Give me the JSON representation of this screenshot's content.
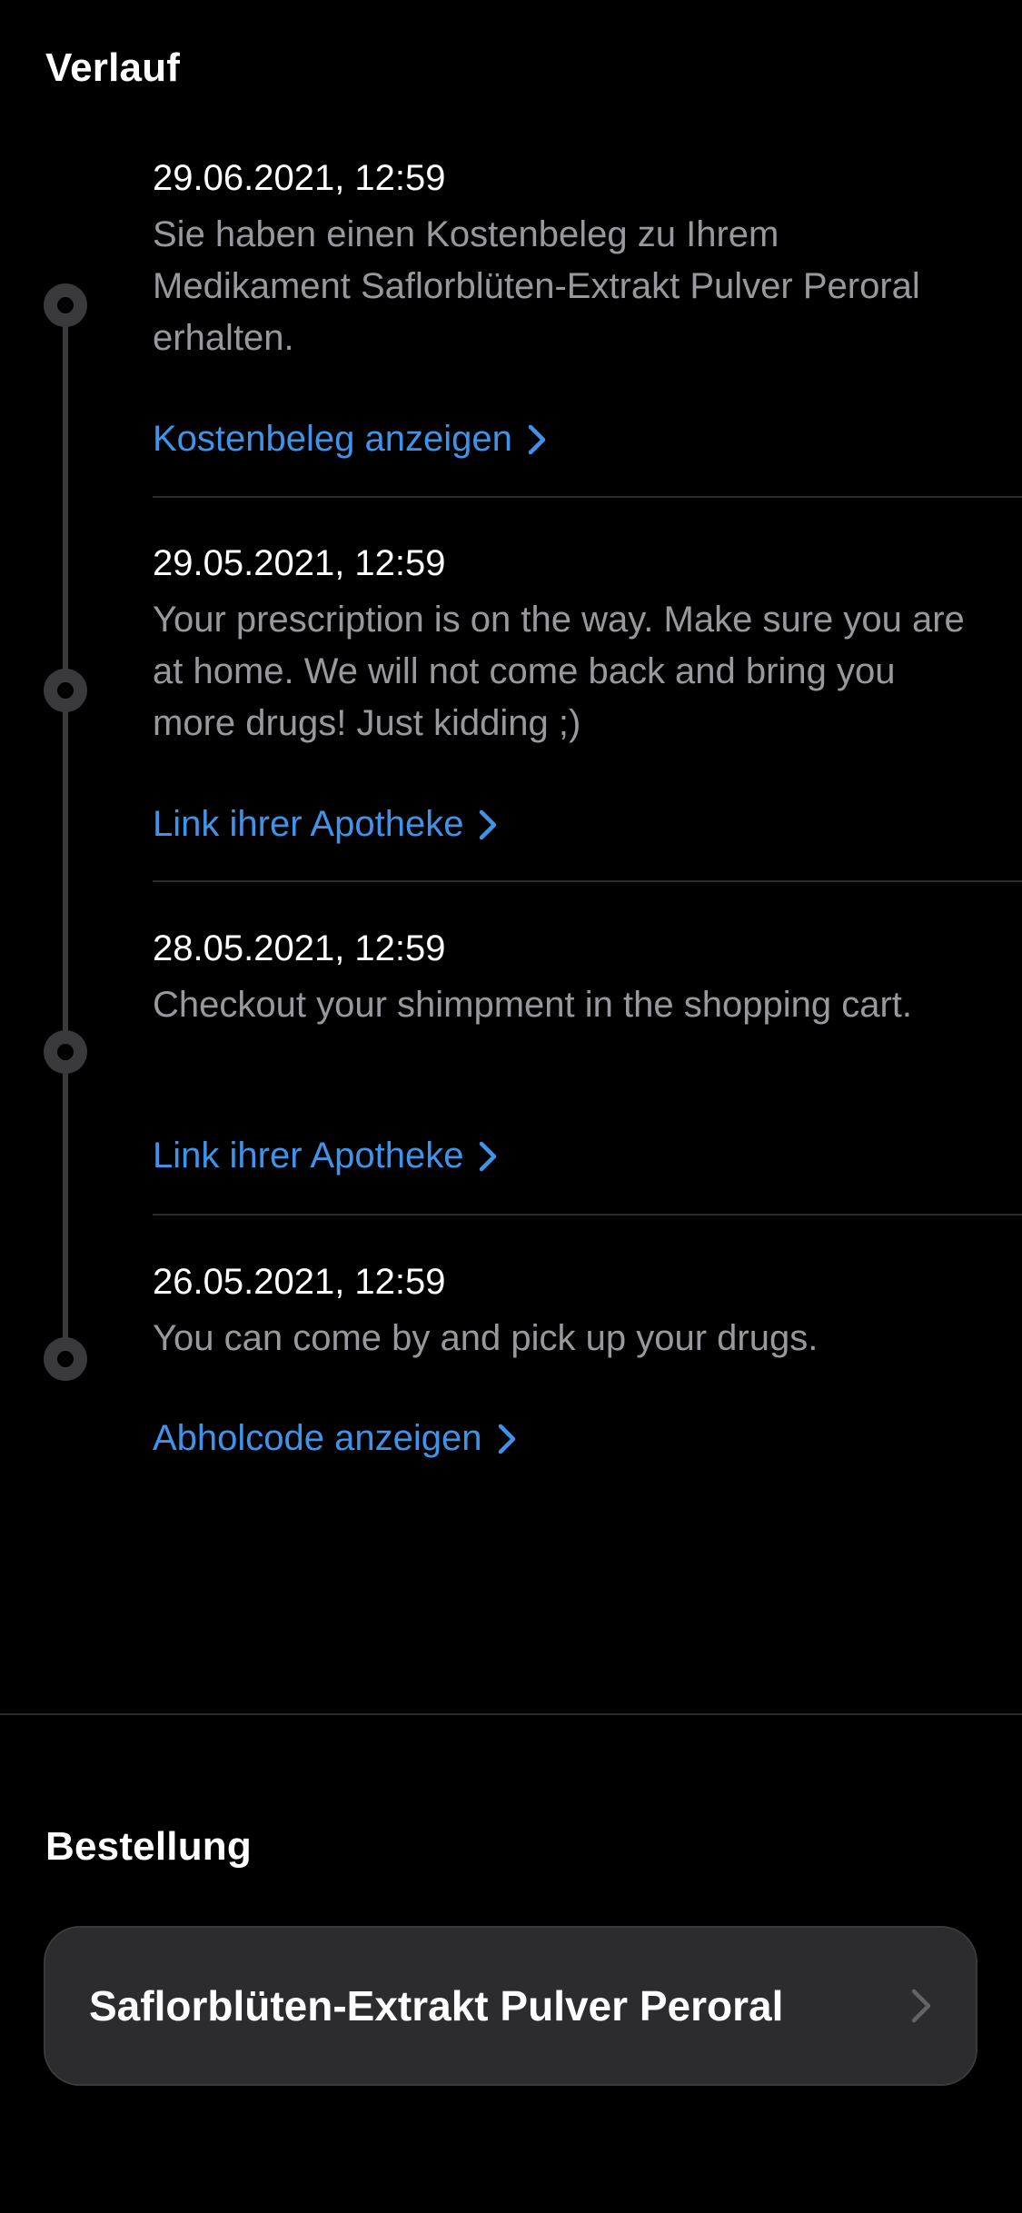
{
  "history": {
    "title": "Verlauf",
    "entries": [
      {
        "date": "29.06.2021, 12:59",
        "text": "Sie haben einen Kostenbeleg zu Ihrem Medikament Saflorblüten-Extrakt Pulver Peroral erhalten.",
        "link": "Kostenbeleg anzeigen"
      },
      {
        "date": "29.05.2021, 12:59",
        "text": "Your prescription is on the way. Make sure you are at home. We will not come back and bring you more drugs! Just kidding ;)",
        "link": "Link ihrer Apotheke"
      },
      {
        "date": "28.05.2021, 12:59",
        "text": "Checkout your shimpment in the shopping cart.",
        "link": "Link ihrer Apotheke"
      },
      {
        "date": "26.05.2021, 12:59",
        "text": "You can come by and pick up your drugs.",
        "link": "Abholcode anzeigen"
      }
    ]
  },
  "order": {
    "title": "Bestellung",
    "item": "Saflorblüten-Extrakt Pulver Peroral"
  },
  "colors": {
    "background": "#000000",
    "link": "#3f94e9",
    "secondary_text": "#98989d",
    "card": "#2c2c2e"
  }
}
